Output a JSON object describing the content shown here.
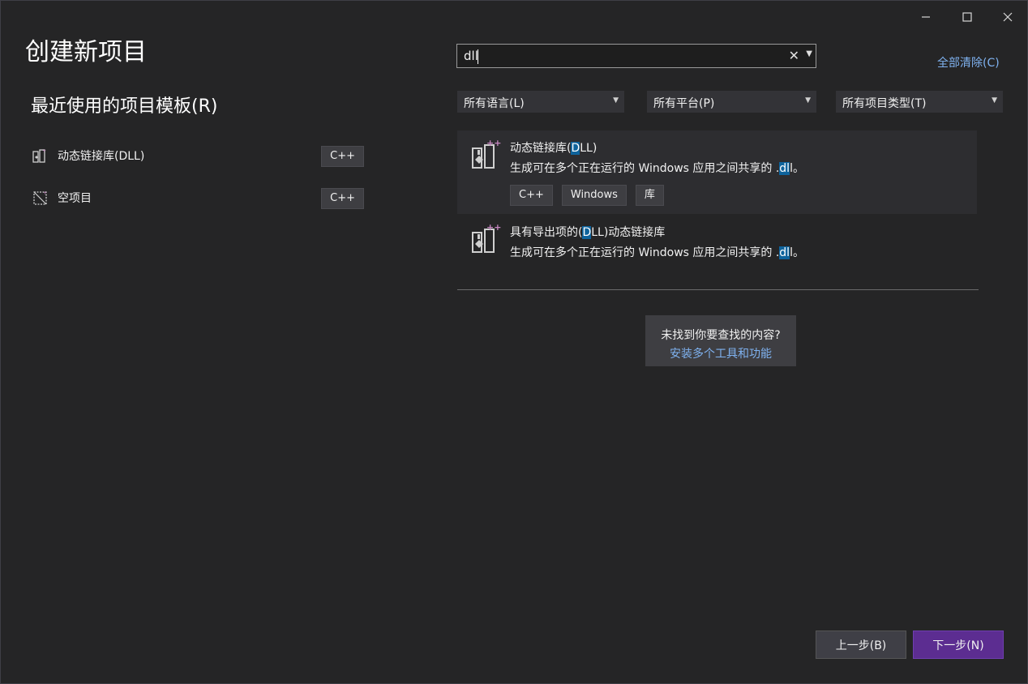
{
  "window": {
    "minimize_icon": "minimize-icon",
    "maximize_icon": "maximize-icon",
    "close_icon": "close-icon"
  },
  "title": "创建新项目",
  "recent": {
    "heading": "最近使用的项目模板(R)",
    "items": [
      {
        "label": "动态链接库(DLL)",
        "tag": "C++",
        "icon": "dll-project-icon"
      },
      {
        "label": "空项目",
        "tag": "C++",
        "icon": "empty-project-icon"
      }
    ]
  },
  "search": {
    "value": "dll",
    "clear_icon": "clear-icon",
    "dropdown_icon": "chevron-down-icon"
  },
  "clear_all": "全部清除(C)",
  "filters": {
    "language": "所有语言(L)",
    "platform": "所有平台(P)",
    "project_type": "所有项目类型(T)"
  },
  "results": [
    {
      "title_pre": "动态链接库(",
      "title_hl": "D",
      "title_post": "LL)",
      "desc_pre": "生成可在多个正在运行的 Windows 应用之间共享的 .",
      "desc_hl": "dl",
      "desc_post": "l。",
      "tags": [
        "C++",
        "Windows",
        "库"
      ],
      "selected": true
    },
    {
      "title_pre": "具有导出项的(",
      "title_hl": "D",
      "title_post": "LL)动态链接库",
      "desc_pre": "生成可在多个正在运行的 Windows 应用之间共享的 .",
      "desc_hl": "dl",
      "desc_post": "l。",
      "tags": [],
      "selected": false
    }
  ],
  "not_found": {
    "question": "未找到你要查找的内容?",
    "link": "安装多个工具和功能"
  },
  "buttons": {
    "back": "上一步(B)",
    "next": "下一步(N)"
  },
  "colors": {
    "background": "#252526",
    "accent": "#5c2d91",
    "link": "#7fb2f0",
    "highlight": "#0e639c"
  }
}
